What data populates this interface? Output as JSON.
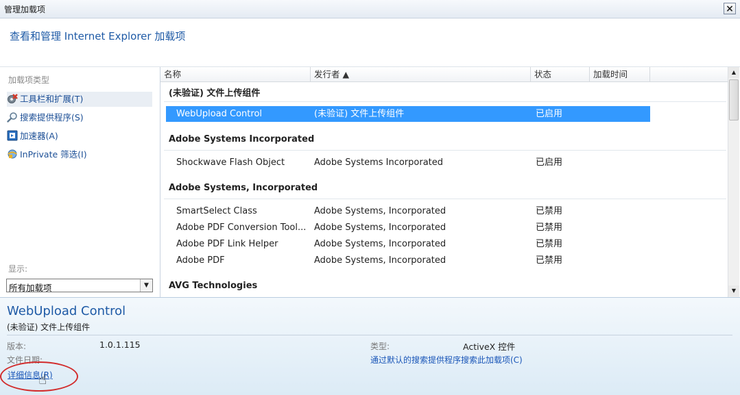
{
  "window": {
    "title": "管理加载项",
    "close_label": "×"
  },
  "header": {
    "heading": "查看和管理 Internet Explorer 加载项"
  },
  "sidebar": {
    "types_label": "加载项类型",
    "items": [
      {
        "label": "工具栏和扩展(T)",
        "icon": "toolbar-icon",
        "selected": true
      },
      {
        "label": "搜索提供程序(S)",
        "icon": "search-icon",
        "selected": false
      },
      {
        "label": "加速器(A)",
        "icon": "accelerator-icon",
        "selected": false
      },
      {
        "label": "InPrivate 筛选(I)",
        "icon": "inprivate-icon",
        "selected": false
      }
    ],
    "show_label": "显示:",
    "show_select": {
      "value": "所有加载项"
    }
  },
  "list": {
    "columns": [
      "名称",
      "发行者 ▲",
      "状态",
      "加载时间"
    ],
    "groups": [
      {
        "name": "(未验证) 文件上传组件",
        "rows": [
          {
            "name": "WebUpload Control",
            "publisher": "(未验证) 文件上传组件",
            "status": "已启用",
            "selected": true
          }
        ]
      },
      {
        "name": "Adobe Systems Incorporated",
        "rows": [
          {
            "name": "Shockwave Flash Object",
            "publisher": "Adobe Systems Incorporated",
            "status": "已启用"
          }
        ]
      },
      {
        "name": "Adobe Systems, Incorporated",
        "rows": [
          {
            "name": "SmartSelect Class",
            "publisher": "Adobe Systems, Incorporated",
            "status": "已禁用"
          },
          {
            "name": "Adobe PDF Conversion Tool...",
            "publisher": "Adobe Systems, Incorporated",
            "status": "已禁用"
          },
          {
            "name": "Adobe PDF Link Helper",
            "publisher": "Adobe Systems, Incorporated",
            "status": "已禁用"
          },
          {
            "name": "Adobe PDF",
            "publisher": "Adobe Systems, Incorporated",
            "status": "已禁用"
          }
        ]
      },
      {
        "name": "AVG Technologies",
        "rows": []
      }
    ]
  },
  "details": {
    "name": "WebUpload Control",
    "publisher": "(未验证) 文件上传组件",
    "version_label": "版本:",
    "version_value": "1.0.1.115",
    "file_date_label": "文件日期:",
    "more_info_link": "详细信息(R)",
    "type_label": "类型:",
    "type_value": "ActiveX 控件",
    "search_link": "通过默认的搜索提供程序搜索此加载项(C)"
  }
}
